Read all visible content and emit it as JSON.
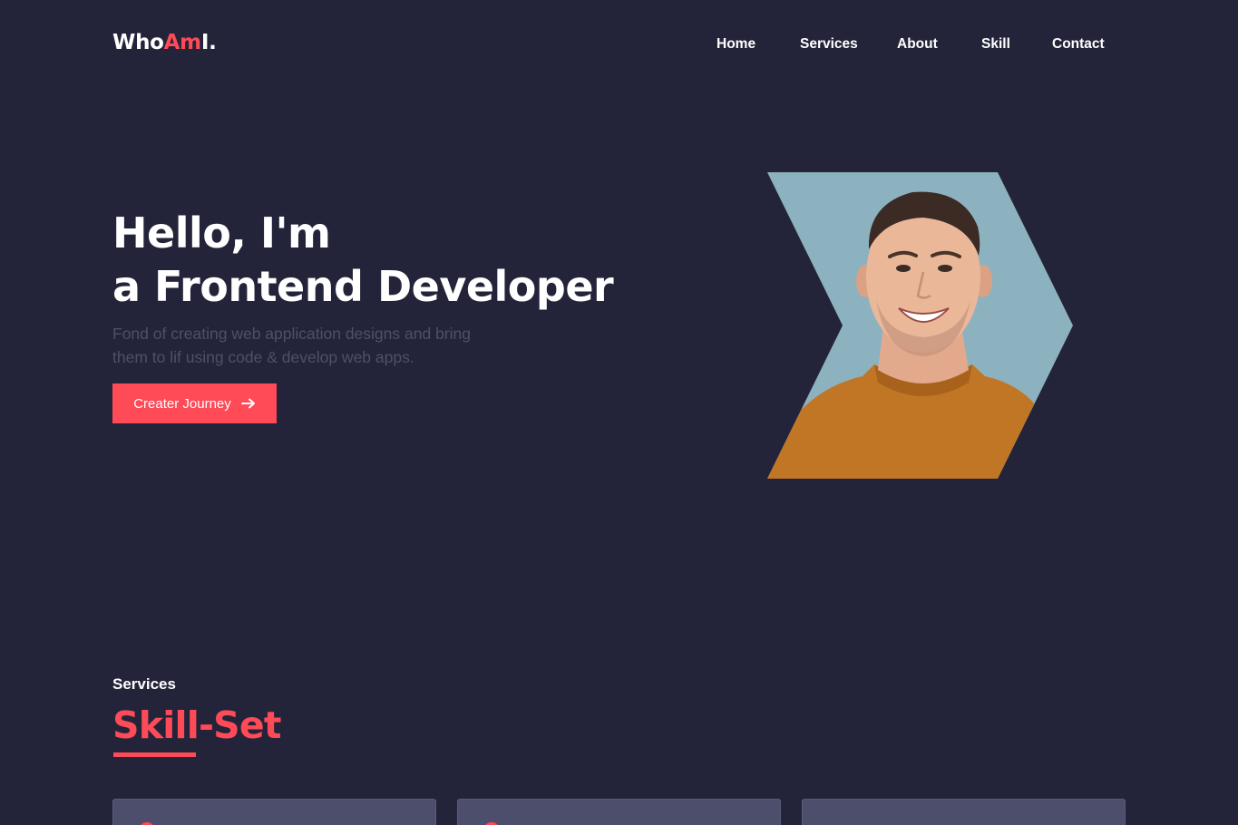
{
  "brand": {
    "prefix": "Who",
    "accent": "Am",
    "suffix": "I."
  },
  "nav": [
    "Home",
    "Services",
    "About",
    "Skill",
    "Contact"
  ],
  "hero": {
    "title_line1": "Hello, I'm",
    "title_line2": "a Frontend Developer",
    "subtitle_line1": "Fond of creating web application designs and bring",
    "subtitle_line2": "them to lif using code & develop web apps.",
    "cta_label": "Creater Journey"
  },
  "services": {
    "label": "Services",
    "title": "Skill-Set"
  },
  "colors": {
    "background": "#23243a",
    "accent": "#ff4a57",
    "card": "#4d4e6c",
    "muted_text": "#4f5068"
  },
  "icons": {
    "cta": "arrow-right-icon"
  }
}
